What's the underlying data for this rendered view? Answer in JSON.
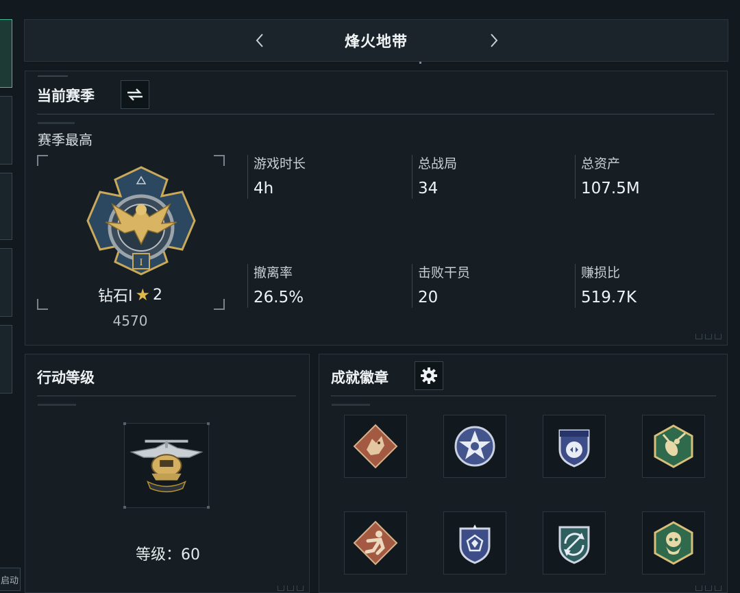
{
  "sidebar": {
    "bottom_label": "启动"
  },
  "header": {
    "title": "烽火地带"
  },
  "season": {
    "title": "当前赛季",
    "subtitle": "赛季最高",
    "rank": {
      "name": "钻石I",
      "stars": "2",
      "score": "4570"
    },
    "stats": [
      {
        "label": "游戏时长",
        "value": "4h"
      },
      {
        "label": "总战局",
        "value": "34"
      },
      {
        "label": "总资产",
        "value": "107.5M"
      },
      {
        "label": "撤离率",
        "value": "26.5%"
      },
      {
        "label": "击败干员",
        "value": "20"
      },
      {
        "label": "赚损比",
        "value": "519.7K"
      }
    ]
  },
  "action_level": {
    "title": "行动等级",
    "level_text": "等级：60"
  },
  "achievements": {
    "title": "成就徽章",
    "badges": [
      {
        "icon": "dragon-badge-icon",
        "color": "#b8644a"
      },
      {
        "icon": "star-shield-badge-icon",
        "color": "#4a5d9a"
      },
      {
        "icon": "shield-badge-icon",
        "color": "#3d4f8c"
      },
      {
        "icon": "wasp-badge-icon",
        "color": "#3f7a5a"
      },
      {
        "icon": "runner-badge-icon",
        "color": "#b8644a"
      },
      {
        "icon": "crest-badge-icon",
        "color": "#4a5d9a"
      },
      {
        "icon": "arrows-badge-icon",
        "color": "#3e6f6a"
      },
      {
        "icon": "skull-badge-icon",
        "color": "#3f7a5a"
      }
    ]
  }
}
